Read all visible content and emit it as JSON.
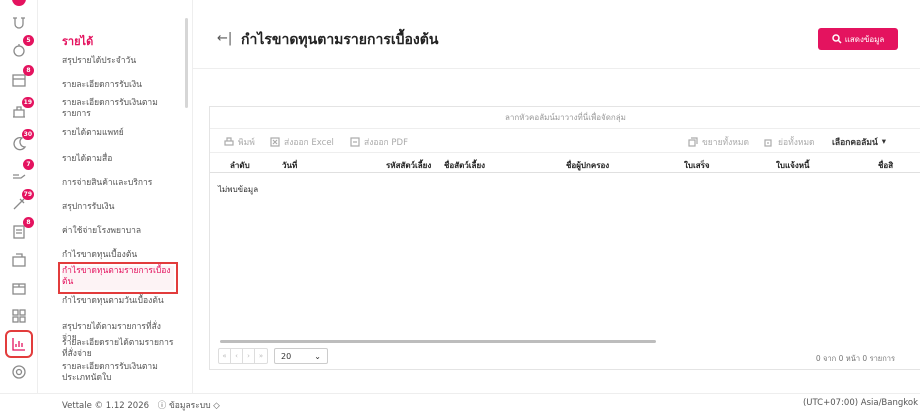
{
  "rail": {
    "badges": [
      "5",
      "8",
      "19",
      "30",
      "7",
      "79",
      "8"
    ]
  },
  "sidebar": {
    "title": "รายได้",
    "items": [
      "สรุปรายได้ประจำวัน",
      "รายละเอียดการรับเงิน",
      "รายละเอียดการรับเงินตามรายการ",
      "รายได้ตามแพทย์",
      "รายได้ตามสื่อ",
      "การจ่ายสินค้าและบริการ",
      "สรุปการรับเงิน",
      "ค่าใช้จ่ายโรงพยาบาล",
      "กำไรขาดทุนเบื้องต้น",
      "กำไรขาดทุนตามรายการเบื้องต้น",
      "กำไรขาดทุนตามวันเบื้องต้น",
      "สรุปรายได้ตามรายการที่สั่งจ่าย",
      "รายละเอียดรายได้ตามรายการที่สั่งจ่าย",
      "รายละเอียดการรับเงินตามประเภทนัดใบ"
    ]
  },
  "header": {
    "back_icon": "←|",
    "title": "กำไรขาดทุนตามรายการเบื้องต้น",
    "show_button": "แสดงข้อมูล"
  },
  "grid": {
    "group_hint": "ลากหัวคอลัมน์มาวางที่นี่เพื่อจัดกลุ่ม",
    "toolbar": {
      "print": "พิมพ์",
      "export_excel": "ส่งออก Excel",
      "export_pdf": "ส่งออก PDF",
      "expand_all": "ขยายทั้งหมด",
      "collapse_all": "ย่อทั้งหมด",
      "choose_columns": "เลือกคอลัมน์"
    },
    "columns": [
      "ลำดับ",
      "วันที่",
      "รหัสสัตว์เลี้ยง",
      "ชื่อสัตว์เลี้ยง",
      "ชื่อผู้ปกครอง",
      "ใบเสร็จ",
      "ใบแจ้งหนี้",
      "ชื่อสิ"
    ],
    "empty_text": "ไม่พบข้อมูล",
    "pager": {
      "page_size": "20",
      "info": "0 จาก 0 หน้า 0 รายการ"
    }
  },
  "footer": {
    "version": "Vettale © 1.12 2026",
    "system_info": "ข้อมูลระบบ",
    "timezone": "(UTC+07:00) Asia/Bangkok"
  },
  "colors": {
    "accent": "#e4135f",
    "highlight": "#e23c3c"
  }
}
